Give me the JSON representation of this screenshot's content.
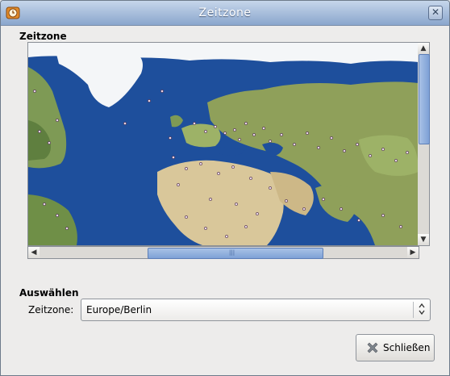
{
  "window": {
    "title": "Zeitzone",
    "close_symbol": "✕",
    "app_icon": "clock-app-icon"
  },
  "map_section": {
    "heading": "Zeitzone",
    "image": "world-map-timezones",
    "colors": {
      "ocean": "#1e4f9c",
      "land": "#8fa05a",
      "desert": "#d9c79a",
      "ice": "#f4f6f8"
    }
  },
  "select_section": {
    "heading": "Auswählen",
    "timezone_label": "Zeitzone:",
    "timezone_value": "Europe/Berlin"
  },
  "buttons": {
    "close_label": "Schließen"
  },
  "icons": {
    "scroll_up": "▲",
    "scroll_down": "▼",
    "scroll_left": "◀",
    "scroll_right": "▶",
    "grip": "|||",
    "combo_arrows": "⌃⌄"
  }
}
